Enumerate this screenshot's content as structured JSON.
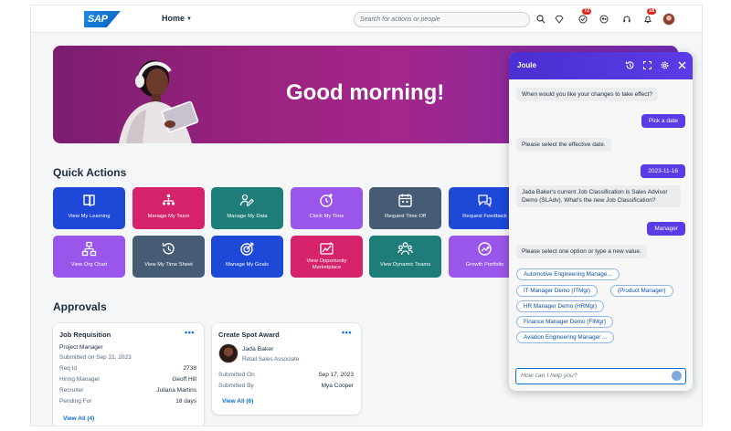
{
  "shell": {
    "logo": "SAP",
    "home_menu": "Home",
    "search_placeholder": "Search for actions or people",
    "notification_counts": {
      "approvals": "72",
      "notifications": "18"
    }
  },
  "hero": {
    "greeting": "Good morning!"
  },
  "quick_actions": {
    "title": "Quick Actions",
    "tiles": [
      {
        "label": "View My Learning",
        "icon": "book-icon",
        "color": "#1e48d8"
      },
      {
        "label": "Manage My Team",
        "icon": "org-team-icon",
        "color": "#d6226a"
      },
      {
        "label": "Manage My Data",
        "icon": "person-edit-icon",
        "color": "#1e7d79"
      },
      {
        "label": "Clock My Time",
        "icon": "clock-add-icon",
        "color": "#9a55ea"
      },
      {
        "label": "Request Time Off",
        "icon": "calendar-icon",
        "color": "#465c75"
      },
      {
        "label": "Request Feedback",
        "icon": "chat-icon",
        "color": "#1e48d8"
      },
      {
        "label": "View Org Chart",
        "icon": "org-chart-icon",
        "color": "#9a55ea"
      },
      {
        "label": "View My Time Sheet",
        "icon": "history-icon",
        "color": "#465c75"
      },
      {
        "label": "Manage My Goals",
        "icon": "target-icon",
        "color": "#1e48d8"
      },
      {
        "label": "View Opportunity Marketplace",
        "icon": "opportunity-icon",
        "color": "#d6226a"
      },
      {
        "label": "View Dynamic Teams",
        "icon": "group-icon",
        "color": "#1e7d79"
      },
      {
        "label": "Growth Portfolio",
        "icon": "growth-icon",
        "color": "#9a55ea"
      }
    ]
  },
  "approvals": {
    "title": "Approvals",
    "job_requisition": {
      "title": "Job Requisition",
      "subtitle": "Project Manager",
      "submitted": "Submitted on Sep 21, 2023",
      "rows": [
        {
          "label": "Req Id",
          "value": "2738"
        },
        {
          "label": "Hiring Manager",
          "value": "Geoff Hill"
        },
        {
          "label": "Recruiter",
          "value": "Juliana Martins"
        },
        {
          "label": "Pending For",
          "value": "18 days"
        }
      ],
      "view_all": "View All (4)"
    },
    "spot_award": {
      "title": "Create Spot Award",
      "person_name": "Jada Baker",
      "person_role": "Retail Sales Associate",
      "rows": [
        {
          "label": "Submitted On",
          "value": "Sep 17, 2023"
        },
        {
          "label": "Submitted By",
          "value": "Mya Cooper"
        }
      ],
      "view_all": "View All (6)"
    }
  },
  "joule": {
    "title": "Joule",
    "messages": [
      {
        "from": "bot",
        "text": "When would you like your changes to take effect?"
      },
      {
        "from": "user",
        "text": "Pick a date"
      },
      {
        "from": "bot",
        "text": "Please select the effective date."
      },
      {
        "from": "user",
        "text": "2023-11-16"
      },
      {
        "from": "bot",
        "text_line1": "Jada Baker's current Job Classification is Sales Advisor",
        "text_line2": "Demo (SLAdv). What's the new Job Classification?"
      },
      {
        "from": "user",
        "text": "Manager"
      },
      {
        "from": "bot",
        "text": "Please select one option or type a new value."
      }
    ],
    "options": [
      "Automotive Engineering Manage...",
      "IT Manager Demo (ITMgr)",
      "(Product Manager)",
      "HR Manager Demo (HRMgr)",
      "Finance Manager Demo (FIMgr)",
      "Aviation Engineering Manager ..."
    ],
    "input_placeholder": "How can I help you?"
  }
}
